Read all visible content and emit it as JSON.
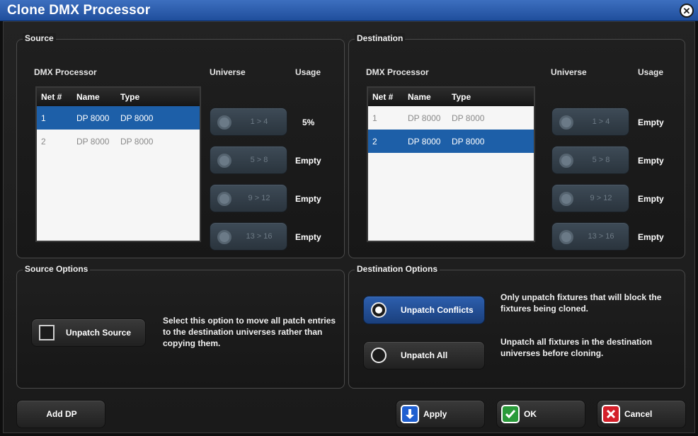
{
  "window": {
    "title": "Clone DMX Processor",
    "close_icon": "close-circle-icon"
  },
  "source": {
    "group_title": "Source",
    "processor_label": "DMX Processor",
    "universe_label": "Universe",
    "usage_label": "Usage",
    "columns": [
      "Net #",
      "Name",
      "Type"
    ],
    "rows": [
      {
        "net": "1",
        "name": "DP 8000",
        "type": "DP 8000",
        "selected": true
      },
      {
        "net": "2",
        "name": "DP 8000",
        "type": "DP 8000",
        "selected": false
      }
    ],
    "universes": [
      "1 > 4",
      "5 > 8",
      "9 > 12",
      "13 > 16"
    ],
    "usage": [
      "5%",
      "Empty",
      "Empty",
      "Empty"
    ]
  },
  "destination": {
    "group_title": "Destination",
    "processor_label": "DMX Processor",
    "universe_label": "Universe",
    "usage_label": "Usage",
    "columns": [
      "Net #",
      "Name",
      "Type"
    ],
    "rows": [
      {
        "net": "1",
        "name": "DP 8000",
        "type": "DP 8000",
        "selected": false
      },
      {
        "net": "2",
        "name": "DP 8000",
        "type": "DP 8000",
        "selected": true
      }
    ],
    "universes": [
      "1 > 4",
      "5 > 8",
      "9 > 12",
      "13 > 16"
    ],
    "usage": [
      "Empty",
      "Empty",
      "Empty",
      "Empty"
    ]
  },
  "source_options": {
    "group_title": "Source Options",
    "unpatch_source_label": "Unpatch Source",
    "description": "Select this option to move all patch entries to the destination universes rather than copying them."
  },
  "destination_options": {
    "group_title": "Destination Options",
    "unpatch_conflicts_label": "Unpatch Conflicts",
    "unpatch_conflicts_desc": "Only unpatch fixtures that will block the fixtures being cloned.",
    "unpatch_all_label": "Unpatch All",
    "unpatch_all_desc": "Unpatch all fixtures in the destination universes before cloning."
  },
  "footer": {
    "add_dp_label": "Add DP",
    "apply_label": "Apply",
    "ok_label": "OK",
    "cancel_label": "Cancel"
  },
  "colors": {
    "title_bar": "#2a5aa8",
    "selection": "#1d5fa8",
    "apply_icon": "#1f5fd0",
    "ok_icon": "#2a9a3a",
    "cancel_icon": "#d4202a"
  }
}
